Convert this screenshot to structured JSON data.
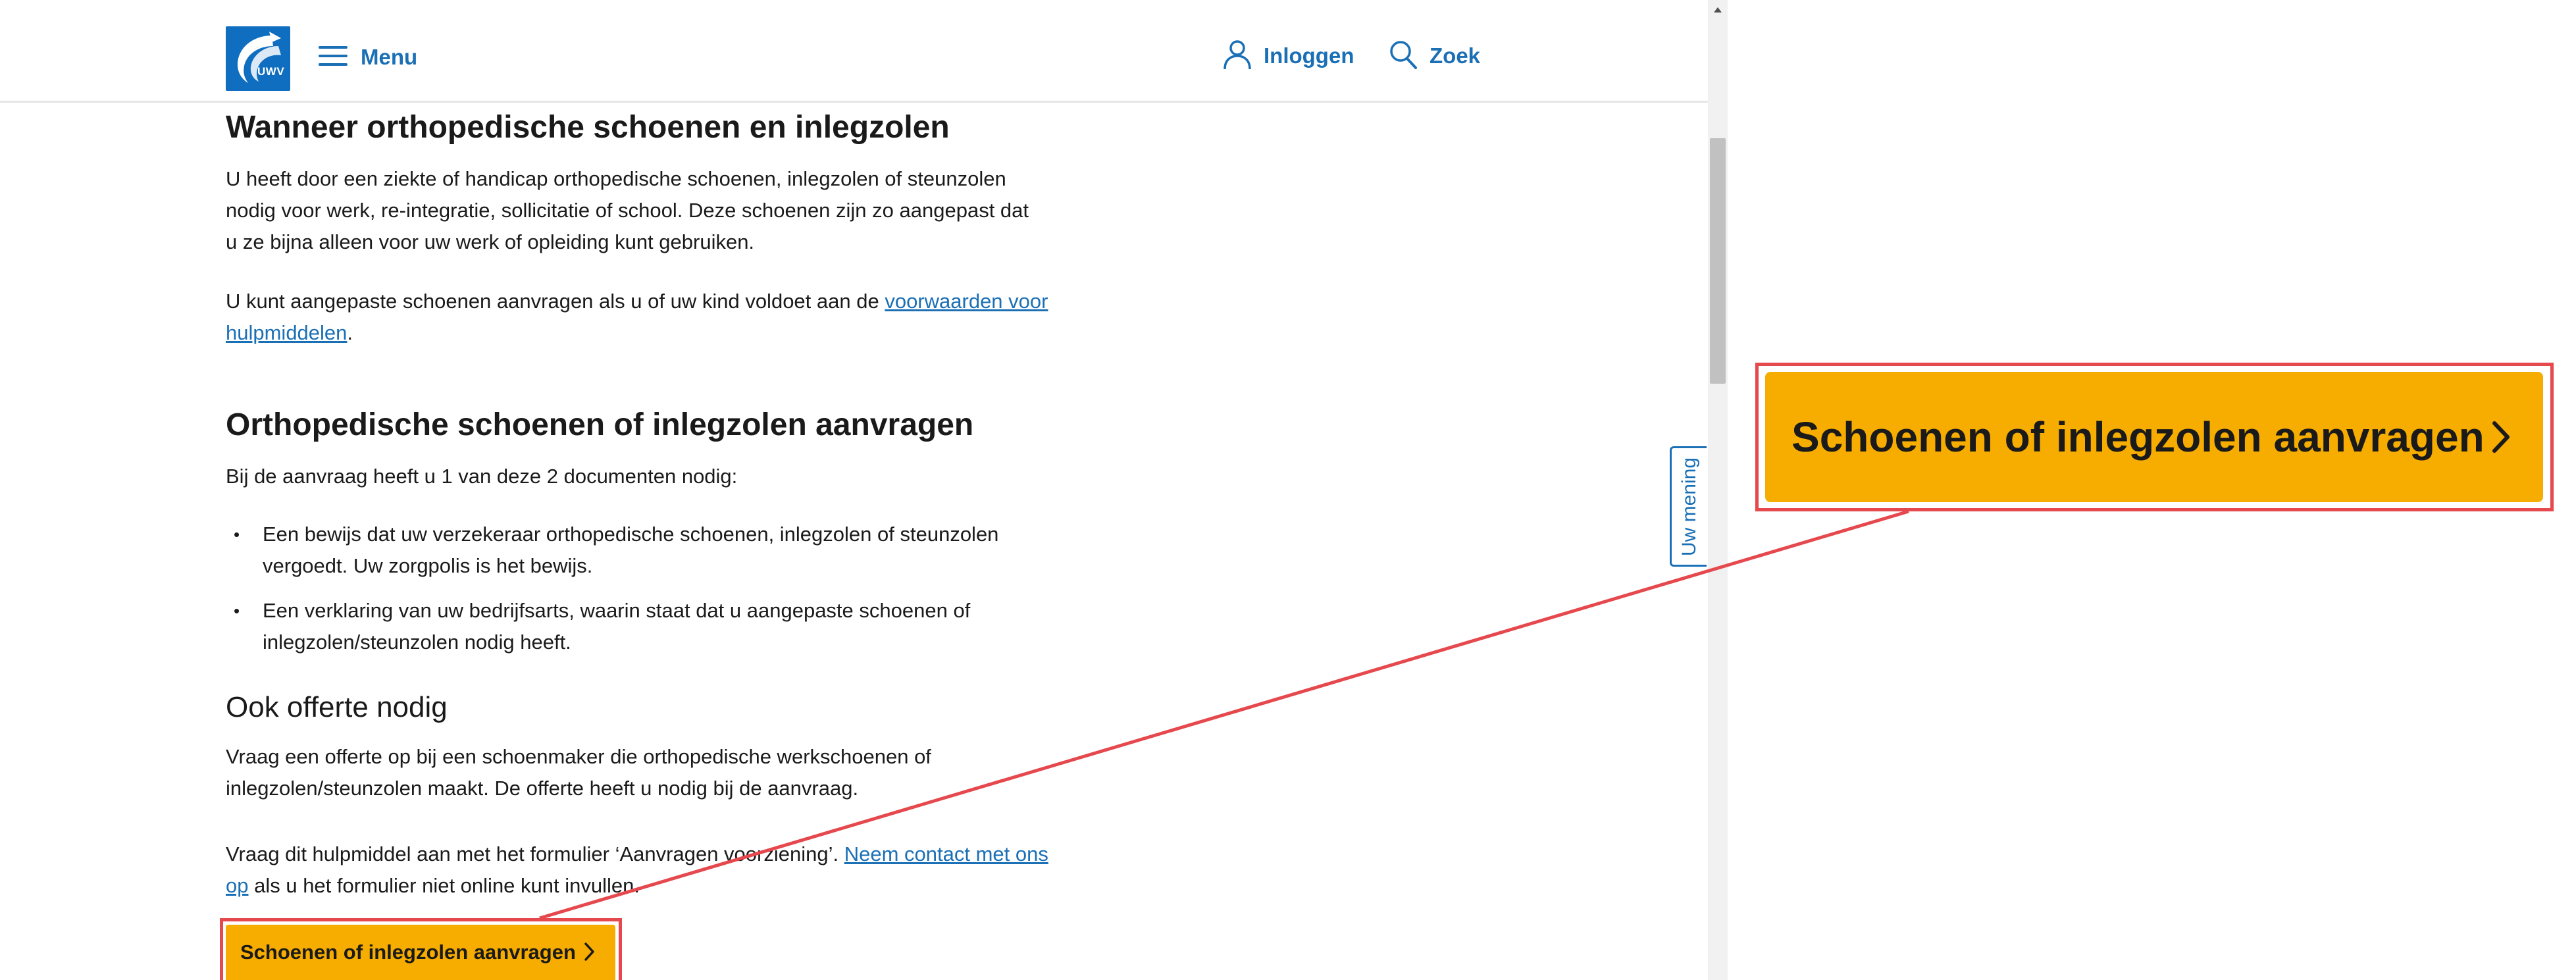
{
  "header": {
    "logo_text": "UWV",
    "menu_label": "Menu",
    "login_label": "Inloggen",
    "search_label": "Zoek"
  },
  "sections": {
    "when": {
      "heading": "Wanneer orthopedische schoenen en inlegzolen",
      "para1_lines": [
        "U heeft door een ziekte of handicap orthopedische schoenen, inlegzolen of steunzolen",
        "nodig voor werk, re-integratie, sollicitatie of school. Deze schoenen zijn zo aangepast dat",
        "u ze bijna alleen voor uw werk of opleiding kunt gebruiken."
      ],
      "para2_text": "U kunt aangepaste schoenen aanvragen als u of uw kind voldoet aan de ",
      "para2_link": "voorwaarden voor hulpmiddelen",
      "para2_end": "."
    },
    "apply": {
      "heading": "Orthopedische schoenen of inlegzolen aanvragen",
      "intro": "Bij de aanvraag heeft u 1 van deze 2 documenten nodig:",
      "bullets": [
        "Een bewijs dat uw verzekeraar orthopedische schoenen, inlegzolen of steunzolen vergoedt. Uw zorgpolis is het bewijs.",
        "Een verklaring van uw bedrijfsarts, waarin staat dat u aangepaste schoenen of inlegzolen/steunzolen nodig heeft."
      ]
    },
    "quote": {
      "heading": "Ook offerte nodig",
      "para1": "Vraag een offerte op bij een schoenmaker die orthopedische werkschoenen of inlegzolen/steunzolen maakt. De offerte heeft u nodig bij de aanvraag.",
      "para2_text": "Vraag dit hulpmiddel aan met het formulier ‘Aanvragen voorziening’. ",
      "para2_link": "Neem contact met ons op",
      "para2_end": " als u het formulier niet online kunt invullen."
    }
  },
  "cta": {
    "label": "Schoenen of inlegzolen aanvragen"
  },
  "feedback": {
    "label": "Uw mening"
  },
  "zoom": {
    "label": "Schoenen of inlegzolen aanvragen"
  },
  "colors": {
    "brand_blue": "#1a6fb5",
    "cta_yellow": "#f7ac00",
    "highlight_red": "#e5484d"
  },
  "icons": {
    "menu": "hamburger-icon",
    "login": "user-icon",
    "search": "search-icon",
    "cta": "chevron-right-icon"
  }
}
